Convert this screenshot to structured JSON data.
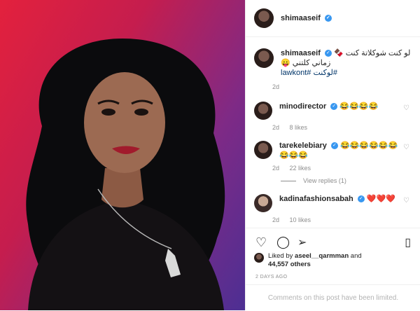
{
  "header": {
    "username": "shimaaseif"
  },
  "caption": {
    "username": "shimaaseif",
    "text": "لو كنت شوكلاتة كنت 🍫 زماني كلتني 😛",
    "hashtags": "#لوكنت #lawkont",
    "time": "2d"
  },
  "comments": [
    {
      "username": "minodirector",
      "text": "😂😂😂😂",
      "time": "2d",
      "likes": "8 likes"
    },
    {
      "username": "tarekelebiary",
      "text": "😂😂😂😂😂😂😂😂😂",
      "time": "2d",
      "likes": "22 likes",
      "view_replies": "View replies (1)"
    },
    {
      "username": "kadinafashionsabah",
      "text": "❤️❤️❤️",
      "time": "2d",
      "likes": "10 likes"
    }
  ],
  "likes": {
    "prefix": "Liked by",
    "user": "aseel__qarmman",
    "and": "and",
    "others": "44,557 others"
  },
  "date": "2 DAYS AGO",
  "footer": "Comments on this post have been limited.",
  "icons": {
    "heart": "heart-outline",
    "comment": "comment-bubble",
    "share": "paper-plane",
    "save": "bookmark"
  }
}
